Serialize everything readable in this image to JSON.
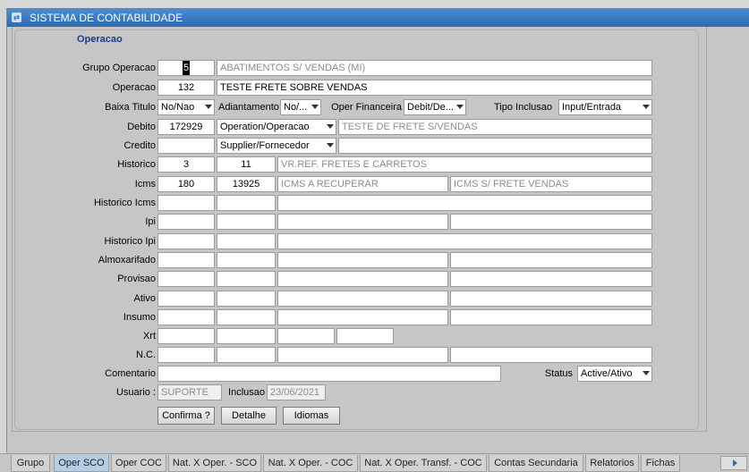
{
  "window": {
    "title": "SISTEMA DE CONTABILIDADE"
  },
  "section": {
    "title": "Operacao"
  },
  "form": {
    "grupo_operacao": {
      "label": "Grupo Operacao",
      "code": "5",
      "desc": "ABATIMENTOS S/ VENDAS (MI)"
    },
    "operacao": {
      "label": "Operacao",
      "code": "132",
      "desc": "TESTE FRETE SOBRE VENDAS"
    },
    "baixa_titulo": {
      "label": "Baixa Titulo",
      "value": "No/Nao"
    },
    "adiantamento": {
      "label": "Adiantamento",
      "value": "No/..."
    },
    "oper_financeira": {
      "label": "Oper Financeira",
      "value": "Debit/De..."
    },
    "tipo_inclusao": {
      "label": "Tipo Inclusao",
      "value": "Input/Entrada"
    },
    "debito": {
      "label": "Debito",
      "code": "172929",
      "type": "Operation/Operacao",
      "desc": "TESTE DE FRETE S/VENDAS"
    },
    "credito": {
      "label": "Credito",
      "code": "",
      "type": "Supplier/Fornecedor",
      "desc": ""
    },
    "historico": {
      "label": "Historico",
      "v1": "3",
      "v2": "11",
      "desc": "VR.REF. FRETES E CARRETOS"
    },
    "icms": {
      "label": "Icms",
      "v1": "180",
      "v2": "13925",
      "desc1": "ICMS A RECUPERAR",
      "desc2": "ICMS S/ FRETE VENDAS"
    },
    "historico_icms": {
      "label": "Historico Icms"
    },
    "ipi": {
      "label": "Ipi"
    },
    "historico_ipi": {
      "label": "Historico Ipi"
    },
    "almoxarifado": {
      "label": "Almoxarifado"
    },
    "provisao": {
      "label": "Provisao"
    },
    "ativo": {
      "label": "Ativo"
    },
    "insumo": {
      "label": "Insumo"
    },
    "xrt": {
      "label": "Xrt"
    },
    "nc": {
      "label": "N.C."
    },
    "comentario": {
      "label": "Comentario",
      "value": ""
    },
    "status": {
      "label": "Status",
      "value": "Active/Ativo"
    },
    "usuario": {
      "label": "Usuario :",
      "value": "SUPORTE"
    },
    "inclusao": {
      "label": "Inclusao",
      "value": "23/06/2021"
    }
  },
  "buttons": {
    "confirma": "Confirma ?",
    "detalhe": "Detalhe",
    "idiomas": "Idiomas"
  },
  "tabs": [
    "Grupo",
    "Oper SCO",
    "Oper COC",
    "Nat. X Oper. - SCO",
    "Nat. X Oper. - COC",
    "Nat. X Oper. Transf. - COC",
    "Contas Secundaria",
    "Relatorios",
    "Fichas"
  ],
  "active_tab": "Oper SCO",
  "colors": {
    "titlebar": "#2a6cb5",
    "section_title": "#1f3a8a",
    "active_tab": "#b6cde6"
  }
}
